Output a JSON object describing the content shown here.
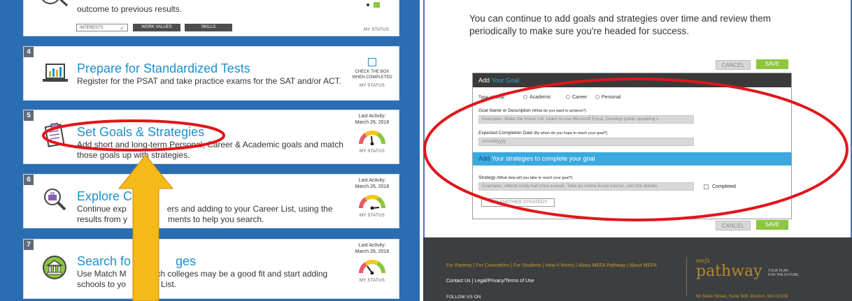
{
  "left": {
    "card_top": {
      "desc_line": "outcome to previous results.",
      "pills": [
        "INTERESTS",
        "WORK VALUES",
        "SKILLS"
      ],
      "check": "✓",
      "status_label": "MY STATUS"
    },
    "cards": [
      {
        "num": "4",
        "title": "Prepare for Standardized Tests",
        "desc": "Register for the PSAT and take practice exams for the SAT and/or ACT.",
        "check_label_1": "CHECK THE BOX",
        "check_label_2": "WHEN COMPLETED",
        "status_label": "MY STATUS"
      },
      {
        "num": "5",
        "title": "Set Goals & Strategies",
        "desc_1": "Add short and long-term Personal, Career & Academic goals and match",
        "desc_2": "those goals up with strategies.",
        "last_activity": "Last Activity:",
        "date": "March 26, 2018",
        "status_label": "MY STATUS"
      },
      {
        "num": "6",
        "title": "Explore C",
        "desc_1": "Continue exp",
        "desc_1b": "ers and adding to your Career List, using the",
        "desc_2": "results from y",
        "desc_2b": "ments to help you search.",
        "last_activity": "Last Activity:",
        "date": "March 26, 2018",
        "status_label": "MY STATUS"
      },
      {
        "num": "7",
        "title": "Search fo",
        "title_b": "ges",
        "desc_1": "Use Match M",
        "desc_1b": "ich colleges may be a good fit and start adding",
        "desc_2": "schools to yo",
        "desc_2b": "List.",
        "last_activity": "Last Activity:",
        "date": "March 26, 2018",
        "status_label": "MY STATUS"
      }
    ]
  },
  "right": {
    "intro": "You can continue to add goals and strategies over time and review them periodically to make sure you're headed for success.",
    "cancel": "CANCEL",
    "save": "SAVE",
    "form": {
      "header_a": "Add ",
      "header_b": "Your Goal",
      "type_label": "Type of Goal",
      "options": [
        "Academic",
        "Career",
        "Personal"
      ],
      "name_label": "Goal Name or Description",
      "name_hint": "(What do you want to achieve?)",
      "name_placeholder": "Examples: Make the honor roll, Learn to use Microsoft Excel, Develop public speaking s",
      "date_label": "Expected Completion Date",
      "date_hint": "(By when do you hope to reach your goal?)",
      "date_placeholder": "mm/dd/yyyy",
      "strategies_a": "Add ",
      "strategies_b": "Your strategies to complete your goal",
      "strategy_label": "Strategy",
      "strategy_hint": "(What step will you take to reach your goal?)",
      "strategy_placeholder": "Examples: Attend study hall once a week, Take an online Excel course, Join the debate",
      "completed": "Completed",
      "add_another": "ADD ANOTHER STRATEGY"
    },
    "footer": {
      "links": "For Parents  |  For Counselors  |  For Students  |  How It Works  |  About MEFA Pathway  |  About MEFA",
      "links2": "Contact Us  |  Legal/Privacy/Terms of Use",
      "follow": "FOLLOW US ON",
      "logo_mefa": "mefa",
      "logo_path": "pathway",
      "logo_tag_1": "YOUR PLAN",
      "logo_tag_2": "FOR THE FUTURE",
      "address": "60 State Street, Suite 900, Boston, MA 02109"
    }
  },
  "colors": {
    "left_bg": "#2a6db3",
    "title_blue": "#1c8fd0",
    "save_green": "#8dc63f",
    "annotation_red": "#e0161b",
    "arrow_gold": "#f6b91a"
  }
}
